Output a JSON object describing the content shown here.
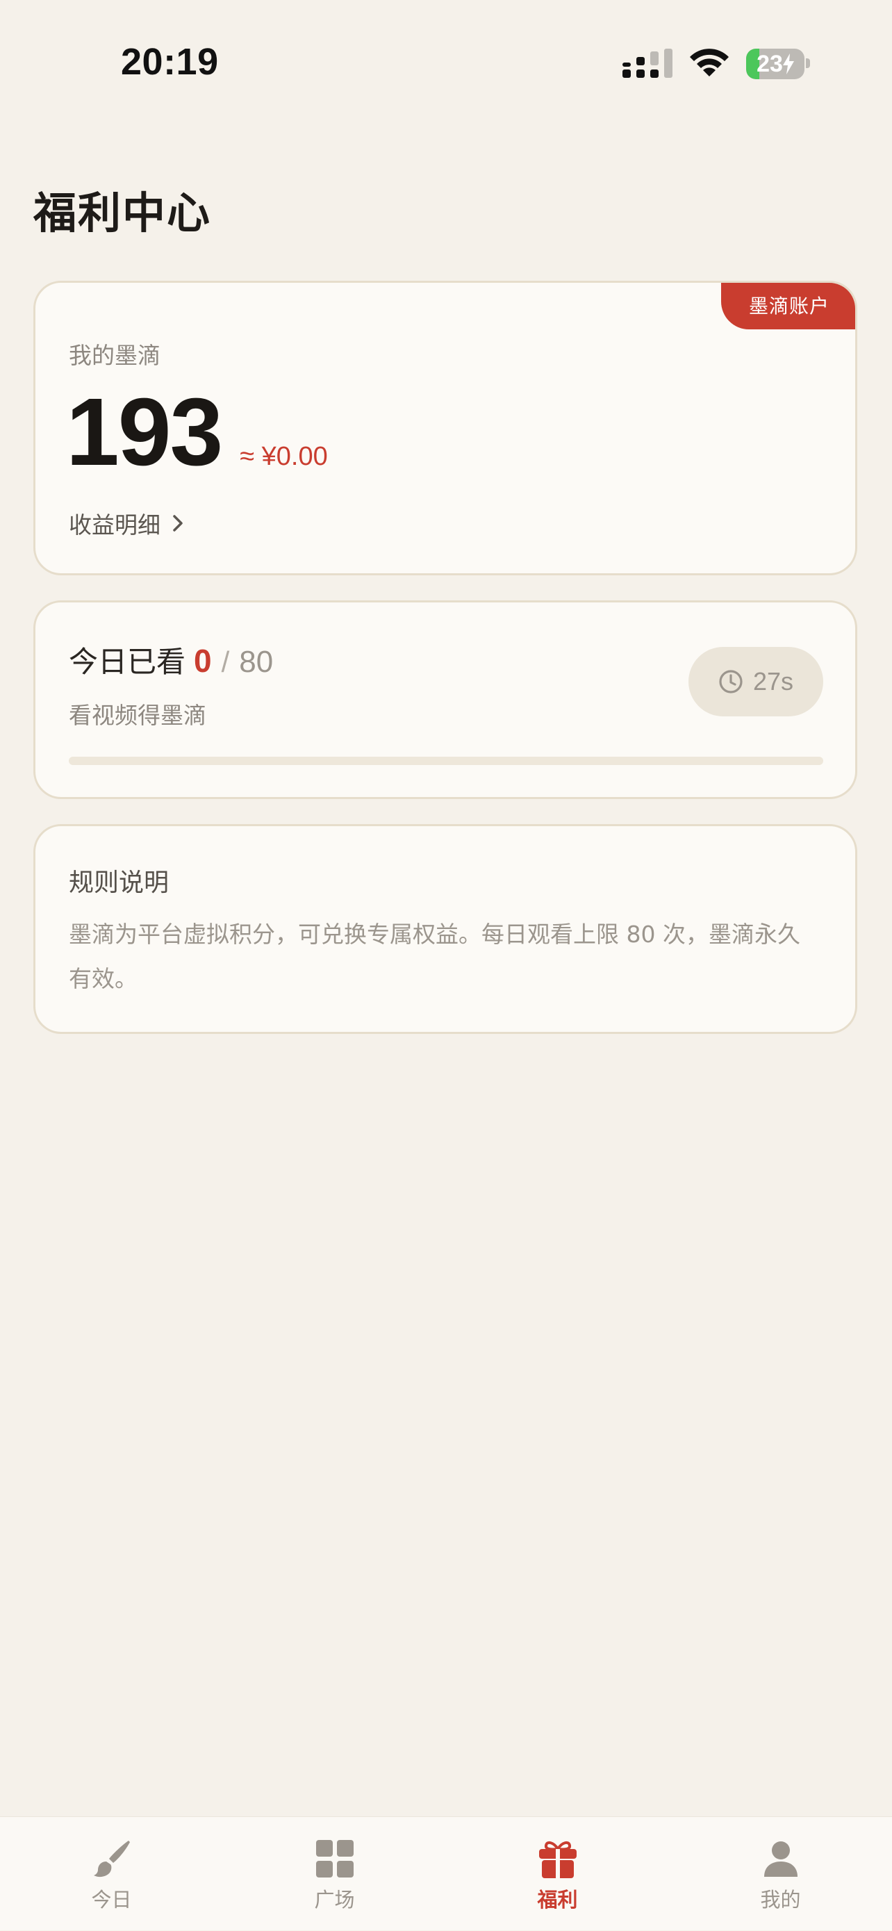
{
  "status_bar": {
    "time": "20:19",
    "battery_level": "23",
    "battery_fraction": 0.23
  },
  "page": {
    "title": "福利中心"
  },
  "balance_card": {
    "tag": "墨滴账户",
    "label": "我的墨滴",
    "value": "193",
    "approx": "≈ ¥0.00",
    "earnings_link": "收益明细"
  },
  "watch_card": {
    "title": "今日已看",
    "count": "0",
    "separator": "/",
    "limit": "80",
    "subtitle": "看视频得墨滴",
    "timer": "27s",
    "progress": 0
  },
  "rules_card": {
    "title": "规则说明",
    "text": "墨滴为平台虚拟积分，可兑换专属权益。每日观看上限 80 次，墨滴永久有效。"
  },
  "tab_bar": {
    "items": [
      {
        "label": "今日",
        "icon": "brush-icon"
      },
      {
        "label": "广场",
        "icon": "grid-icon"
      },
      {
        "label": "福利",
        "icon": "gift-icon",
        "active": true
      },
      {
        "label": "我的",
        "icon": "person-icon"
      }
    ]
  },
  "colors": {
    "accent": "#C93D2F",
    "background": "#F5F1EA",
    "card": "#FCFAF6",
    "muted": "#9B958D",
    "battery_green": "#4CC75B"
  }
}
